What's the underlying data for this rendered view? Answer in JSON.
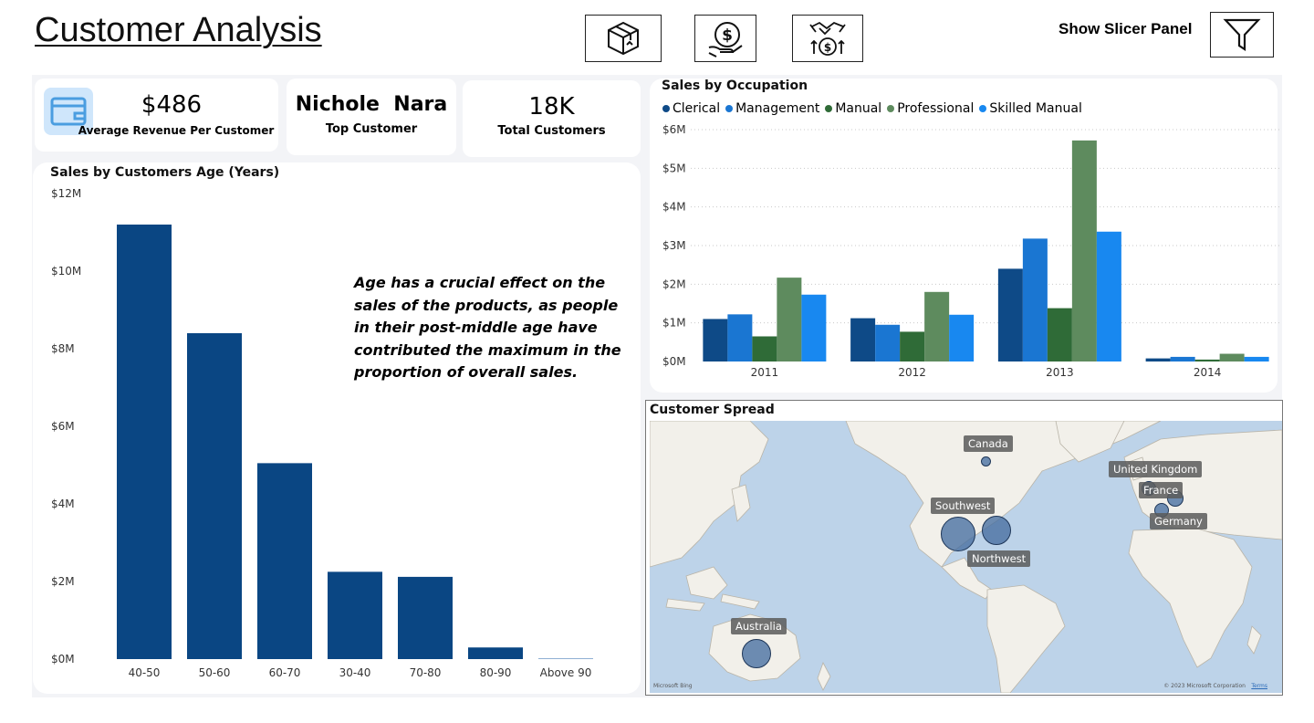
{
  "header": {
    "title": "Customer Analysis",
    "nav_icons": [
      "package-icon",
      "hand-dollar-icon",
      "handshake-growth-icon"
    ],
    "slicer_label": "Show Slicer Panel",
    "slicer_icon": "filter-icon"
  },
  "kpis": {
    "revenue": {
      "value": "$486",
      "label": "Average Revenue Per Customer",
      "icon": "wallet-icon"
    },
    "top_customer": {
      "value": "Nichole  Nara",
      "label": "Top Customer"
    },
    "total_customers": {
      "value": "18K",
      "label": "Total Customers"
    }
  },
  "colors": {
    "age_bar": "#0a4683",
    "clerical": "#0e4a87",
    "management": "#1a76d2",
    "manual": "#2f6b37",
    "professional": "#5e8b5e",
    "skilled_manual": "#1888f0"
  },
  "age_chart": {
    "title": "Sales by Customers Age (Years)",
    "insight": "Age has a crucial effect on the sales of the products, as people in their post-middle age have contributed the maximum in the proportion of overall sales."
  },
  "occupation_chart": {
    "title": "Sales by Occupation"
  },
  "map": {
    "title": "Customer Spread",
    "locations": [
      "Canada",
      "United Kingdom",
      "France",
      "Germany",
      "Southwest",
      "Northwest",
      "Australia"
    ],
    "attribution_left": "Microsoft Bing",
    "attribution_right": "© 2023 Microsoft Corporation",
    "terms": "Terms"
  },
  "chart_data": [
    {
      "type": "bar",
      "title": "Sales by Customers Age (Years)",
      "categories": [
        "40-50",
        "50-60",
        "60-70",
        "30-40",
        "70-80",
        "80-90",
        "Above 90"
      ],
      "values": [
        11.2,
        8.4,
        5.05,
        2.25,
        2.12,
        0.3,
        0.02
      ],
      "unit": "M",
      "yticks": [
        "$0M",
        "$2M",
        "$4M",
        "$6M",
        "$8M",
        "$10M",
        "$12M"
      ],
      "ylim": [
        0,
        12
      ],
      "grid": false
    },
    {
      "type": "bar",
      "title": "Sales by Occupation",
      "categories": [
        "2011",
        "2012",
        "2013",
        "2014"
      ],
      "series": [
        {
          "name": "Clerical",
          "values": [
            1.1,
            1.12,
            2.4,
            0.08
          ]
        },
        {
          "name": "Management",
          "values": [
            1.22,
            0.95,
            3.18,
            0.12
          ]
        },
        {
          "name": "Manual",
          "values": [
            0.65,
            0.77,
            1.38,
            0.05
          ]
        },
        {
          "name": "Professional",
          "values": [
            2.17,
            1.8,
            5.72,
            0.2
          ]
        },
        {
          "name": "Skilled Manual",
          "values": [
            1.73,
            1.21,
            3.36,
            0.12
          ]
        }
      ],
      "unit": "M",
      "yticks": [
        "$0M",
        "$1M",
        "$2M",
        "$3M",
        "$4M",
        "$5M",
        "$6M"
      ],
      "ylim": [
        0,
        6
      ],
      "legend": "top-left",
      "grid": true
    }
  ]
}
